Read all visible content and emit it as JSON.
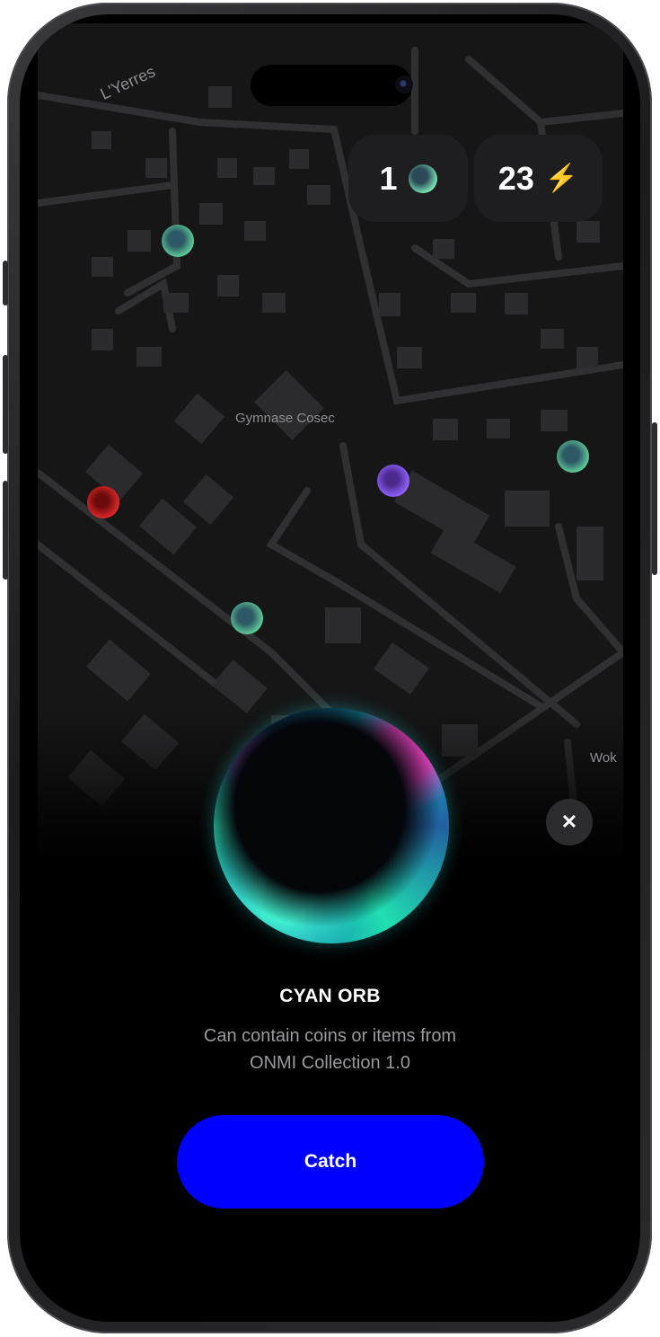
{
  "map": {
    "labels": {
      "river": "L'Yerres",
      "place": "Gymnase Cosec",
      "shop": "Wok"
    }
  },
  "stats": {
    "orbs_count": "1",
    "orb_icon": "green-orb-icon",
    "energy_count": "23",
    "energy_icon": "lightning-bolt-icon"
  },
  "item": {
    "name": "CYAN ORB",
    "description_line1": "Can contain coins or items from",
    "description_line2": "ONMI Collection 1.0"
  },
  "actions": {
    "catch_label": "Catch",
    "close_icon": "close-icon"
  },
  "colors": {
    "button": "#0000FF",
    "background": "#000000",
    "green_orb": "#6FE0A8",
    "red_orb": "#E02828",
    "purple_orb": "#9060FF"
  }
}
